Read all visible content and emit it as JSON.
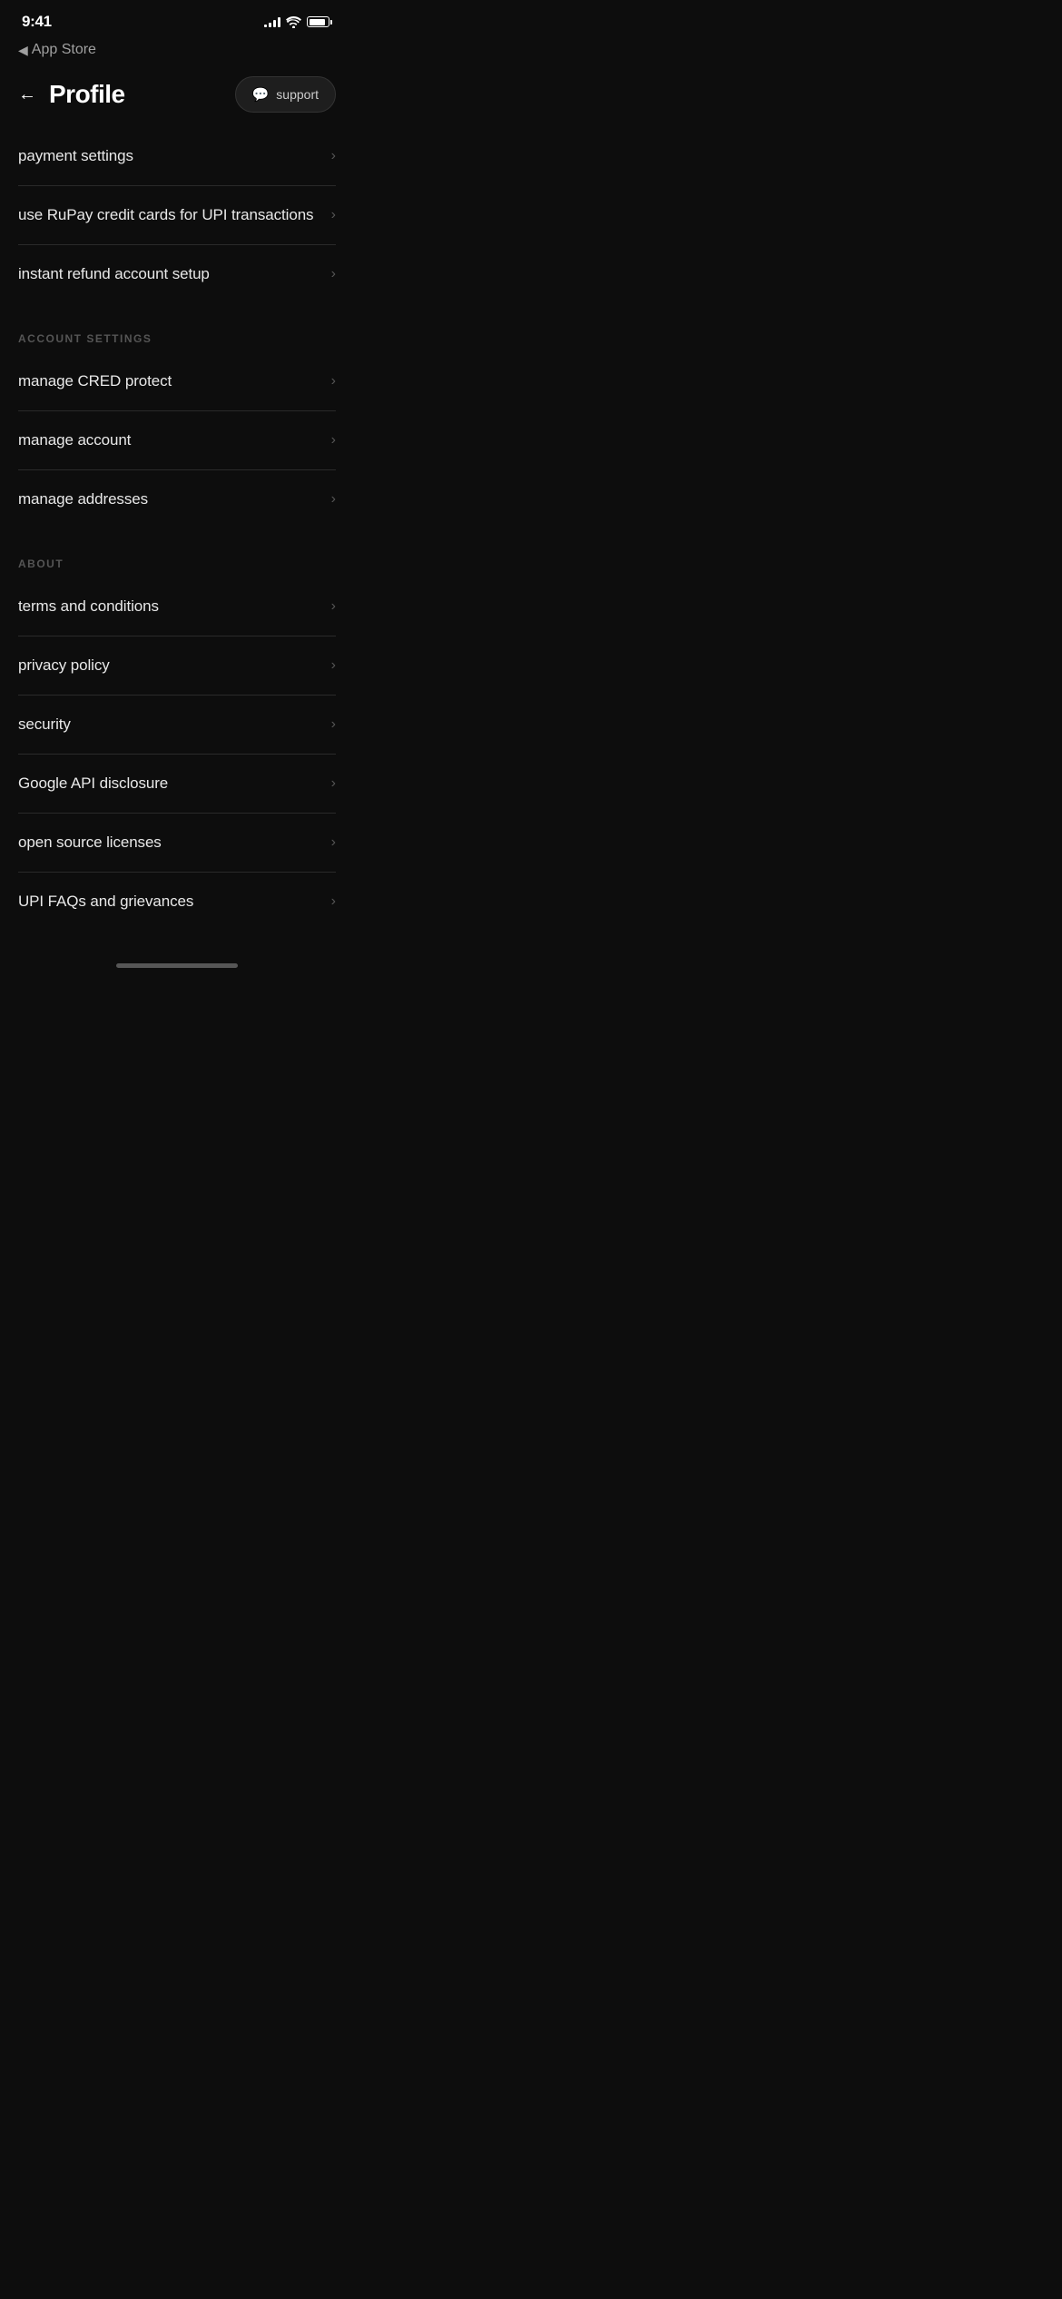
{
  "statusBar": {
    "time": "9:41",
    "backLabel": "App Store"
  },
  "header": {
    "title": "Profile",
    "supportLabel": "support"
  },
  "paymentSection": {
    "items": [
      {
        "id": "payment-settings",
        "label": "payment settings"
      },
      {
        "id": "rupay-credit",
        "label": "use RuPay credit cards for UPI transactions"
      },
      {
        "id": "instant-refund",
        "label": "instant refund account setup"
      }
    ]
  },
  "accountSection": {
    "title": "ACCOUNT SETTINGS",
    "items": [
      {
        "id": "cred-protect",
        "label": "manage CRED protect"
      },
      {
        "id": "manage-account",
        "label": "manage account"
      },
      {
        "id": "manage-addresses",
        "label": "manage addresses"
      }
    ]
  },
  "aboutSection": {
    "title": "ABOUT",
    "items": [
      {
        "id": "terms",
        "label": "terms and conditions"
      },
      {
        "id": "privacy",
        "label": "privacy policy"
      },
      {
        "id": "security",
        "label": "security"
      },
      {
        "id": "google-api",
        "label": "Google API disclosure"
      },
      {
        "id": "open-source",
        "label": "open source licenses"
      },
      {
        "id": "upi-faqs",
        "label": "UPI FAQs and grievances"
      }
    ]
  }
}
